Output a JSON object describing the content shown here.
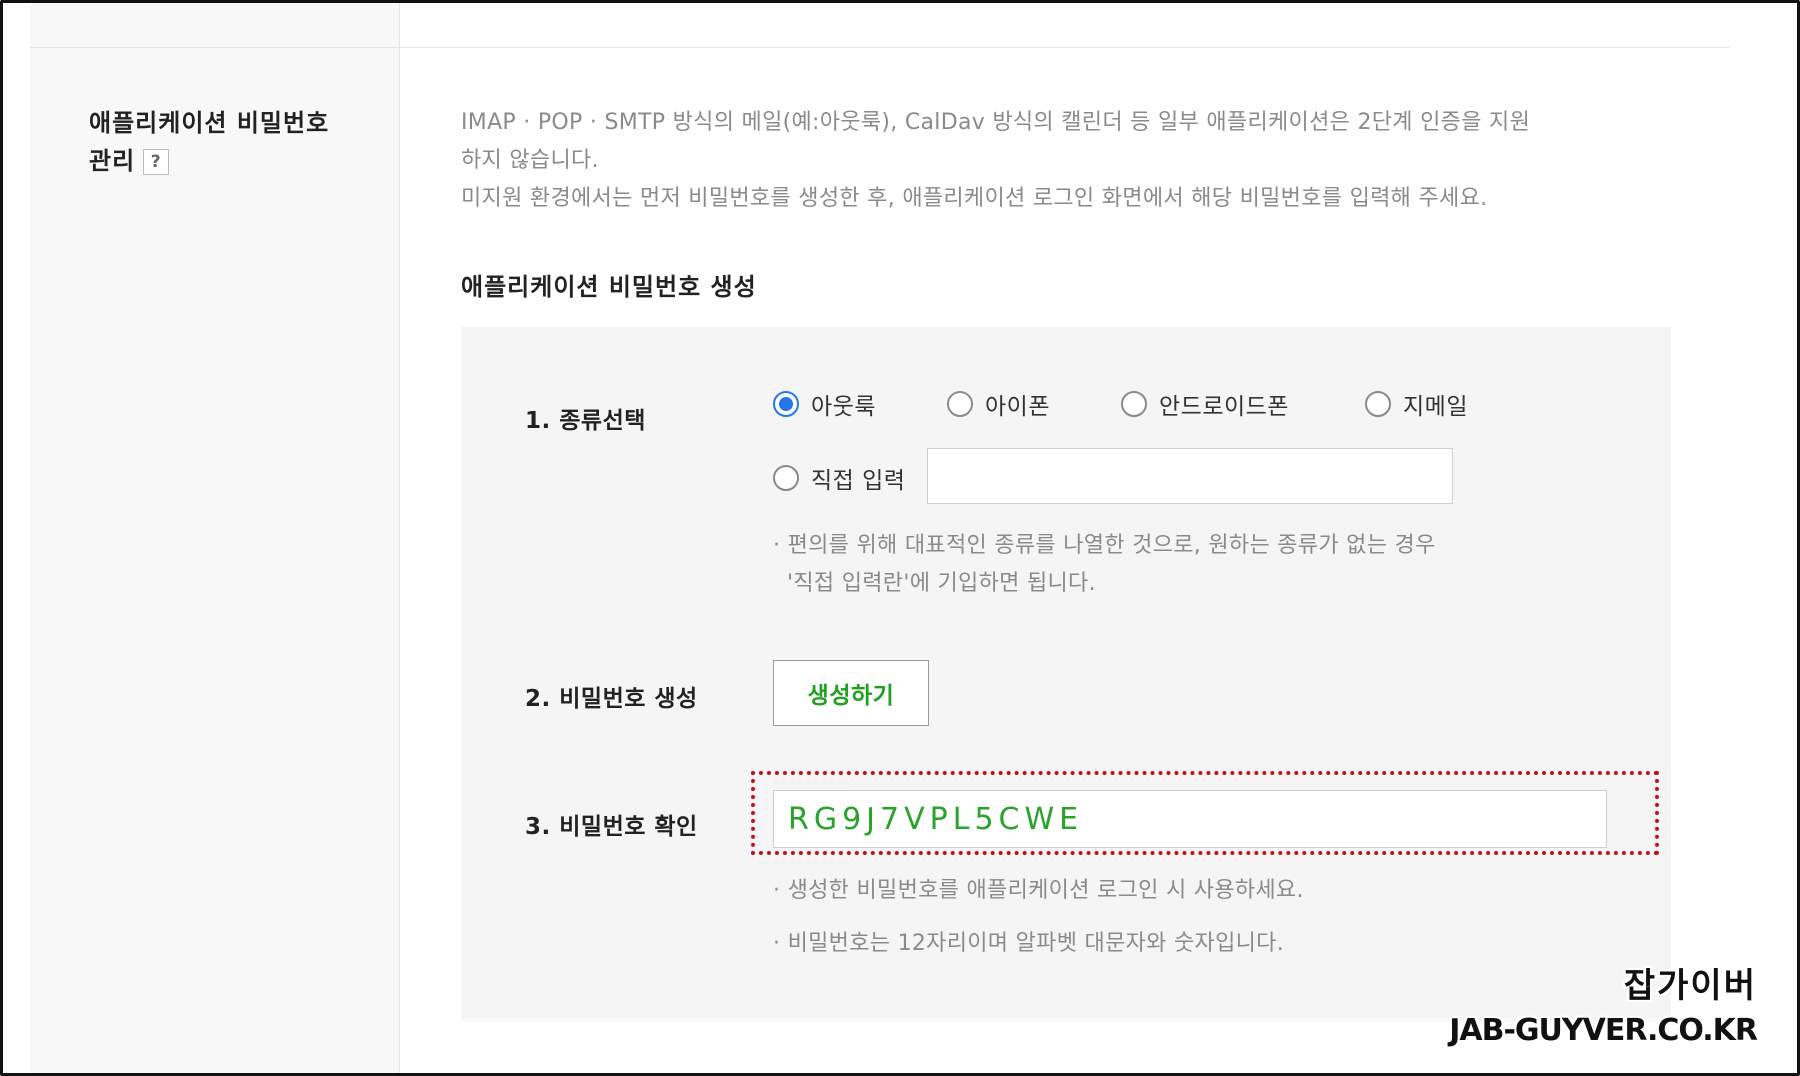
{
  "section": {
    "title_line1": "애플리케이션 비밀번호",
    "title_line2": "관리",
    "help_label": "?"
  },
  "description": {
    "line1": "IMAP · POP · SMTP 방식의 메일(예:아웃룩), CalDav 방식의 캘린더 등 일부 애플리케이션은 2단계 인증을 지원",
    "line2": "하지 않습니다.",
    "line3": "미지원 환경에서는 먼저 비밀번호를 생성한 후, 애플리케이션 로그인 화면에서 해당 비밀번호를 입력해 주세요."
  },
  "generator": {
    "title": "애플리케이션 비밀번호 생성",
    "step1_label": "1. 종류선택",
    "options": [
      {
        "label": "아웃룩",
        "checked": true
      },
      {
        "label": "아이폰",
        "checked": false
      },
      {
        "label": "안드로이드폰",
        "checked": false
      },
      {
        "label": "지메일",
        "checked": false
      },
      {
        "label": "직접 입력",
        "checked": false
      }
    ],
    "custom_input_value": "",
    "note1_line1": "· 편의를 위해 대표적인 종류를 나열한 것으로, 원하는 종류가 없는 경우",
    "note1_line2": "'직접 입력란'에 기입하면 됩니다.",
    "step2_label": "2. 비밀번호 생성",
    "generate_button": "생성하기",
    "step3_label": "3. 비밀번호 확인",
    "password_value": "RG9J7VPL5CWE",
    "note2": "· 생성한 비밀번호를 애플리케이션 로그인 시 사용하세요.",
    "note3": "· 비밀번호는 12자리이며 알파벳 대문자와 숫자입니다."
  },
  "watermark": {
    "korean": "잡가이버",
    "domain": "JAB-GUYVER.CO.KR"
  },
  "colors": {
    "radio_checked": "#2477e8",
    "button_text": "#1fa11f",
    "password_text": "#2aa32a",
    "highlight_border": "#c0121a"
  }
}
